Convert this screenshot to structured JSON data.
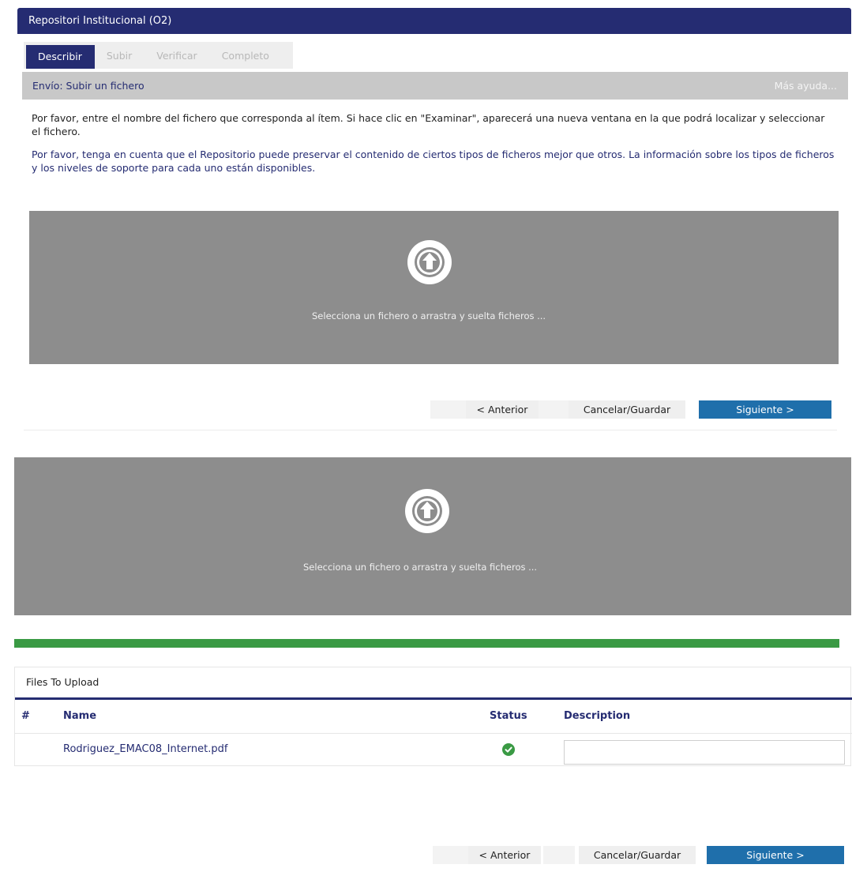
{
  "header": {
    "title": "Repositori Institucional (O2)"
  },
  "tabs": [
    {
      "label": "Describir"
    },
    {
      "label": "Subir"
    },
    {
      "label": "Verificar"
    },
    {
      "label": "Completo"
    }
  ],
  "subheader": {
    "title": "Envío: Subir un fichero",
    "help_link": "Más ayuda..."
  },
  "instructions": {
    "line1": "Por favor, entre el nombre del fichero que corresponda al ítem. Si hace clic en \"Examinar\", aparecerá una nueva ventana en la que podrá localizar y seleccionar el fichero.",
    "line2": "Por favor, tenga en cuenta que el Repositorio puede preservar el contenido de ciertos tipos de ficheros mejor que otros. La información sobre los tipos de ficheros y los niveles de soporte para cada uno están disponibles."
  },
  "dropzone": {
    "text": "Selecciona un fichero o arrastra y suelta ficheros ..."
  },
  "nav": {
    "prev_label": "< Anterior",
    "cancel_label": "Cancelar/Guardar",
    "next_label": "Siguiente >"
  },
  "upload": {
    "progress_percent": 100,
    "panel_title": "Files To Upload",
    "columns": {
      "index": "#",
      "name": "Name",
      "status": "Status",
      "description": "Description"
    },
    "files": [
      {
        "name": "Rodriguez_EMAC08_Internet.pdf",
        "status": "ok",
        "description": ""
      }
    ]
  },
  "colors": {
    "brand": "#252c72",
    "primary_button": "#1f6fab",
    "progress": "#3a9a44",
    "dropzone": "#8d8d8d"
  }
}
